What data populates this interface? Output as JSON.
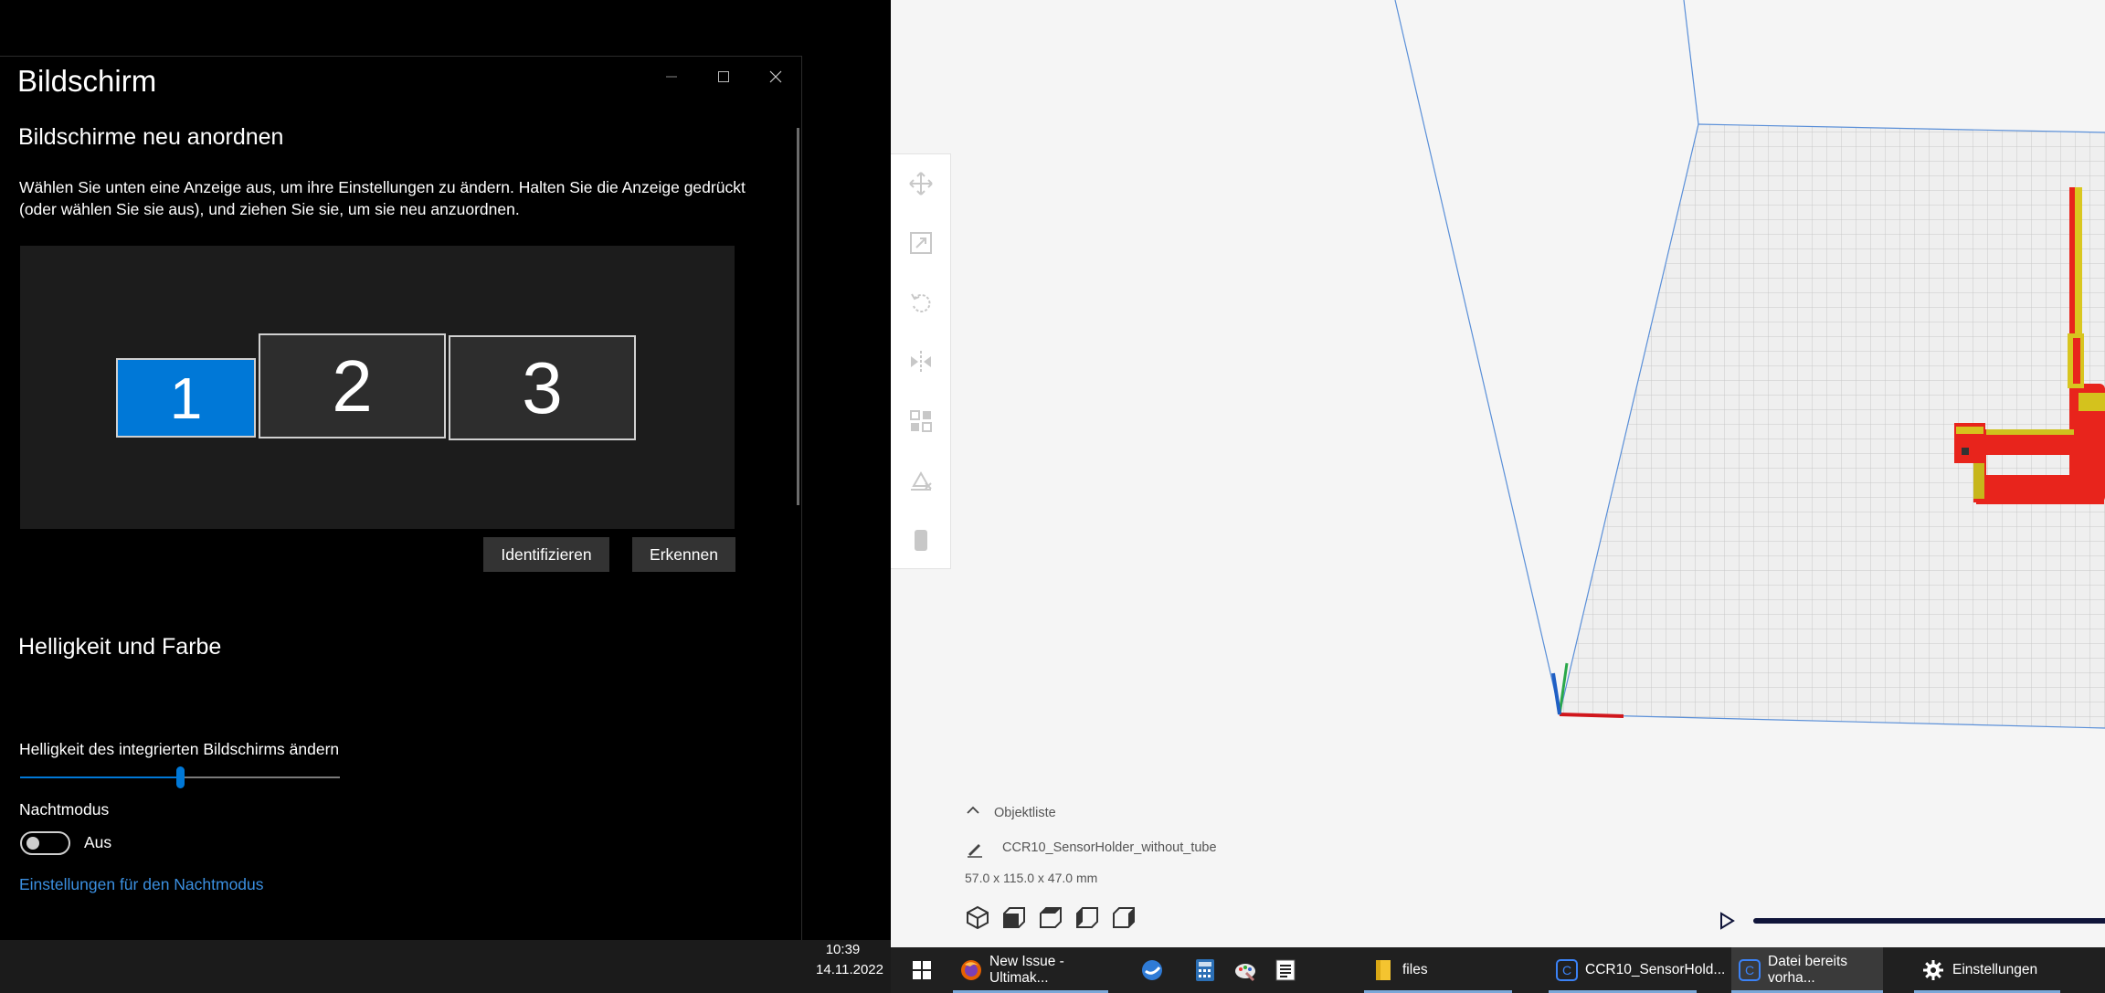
{
  "settings": {
    "title": "Bildschirm",
    "section_arrange": "Bildschirme neu anordnen",
    "description": "Wählen Sie unten eine Anzeige aus, um ihre Einstellungen zu ändern. Halten Sie die Anzeige gedrückt (oder wählen Sie sie aus), und ziehen Sie sie, um sie neu anzuordnen.",
    "monitors": [
      "1",
      "2",
      "3"
    ],
    "selected_monitor": "1",
    "identify_button": "Identifizieren",
    "detect_button": "Erkennen",
    "section_brightness": "Helligkeit und Farbe",
    "brightness_label": "Helligkeit des integrierten Bildschirms ändern",
    "brightness_value": 0.5,
    "nightmode_label": "Nachtmodus",
    "nightmode_state": "Aus",
    "nightmode_link": "Einstellungen für den Nachtmodus",
    "accent_color": "#0078d7"
  },
  "cura": {
    "object_list_label": "Objektliste",
    "object_name": "CCR10_SensorHolder_without_tube",
    "dimensions": "57.0 x 115.0 x 47.0 mm",
    "tools": [
      "move-icon",
      "scale-icon",
      "rotate-icon",
      "mirror-icon",
      "per-model-settings-icon",
      "support-blocker-icon",
      "cylinder-icon"
    ],
    "view_buttons": [
      "3d-view-icon",
      "front-view-icon",
      "top-view-icon",
      "left-view-icon",
      "right-view-icon"
    ]
  },
  "taskbar": {
    "clock_time": "10:39",
    "clock_date": "14.11.2022",
    "items": [
      {
        "label": "New Issue - Ultimak...",
        "icon": "firefox-icon"
      },
      {
        "label": "files",
        "icon": "folder-icon"
      },
      {
        "label": "CCR10_SensorHold...",
        "icon": "cura-icon"
      },
      {
        "label": "Datei bereits vorha...",
        "icon": "cura-icon"
      },
      {
        "label": "Einstellungen",
        "icon": "gear-icon"
      }
    ]
  }
}
